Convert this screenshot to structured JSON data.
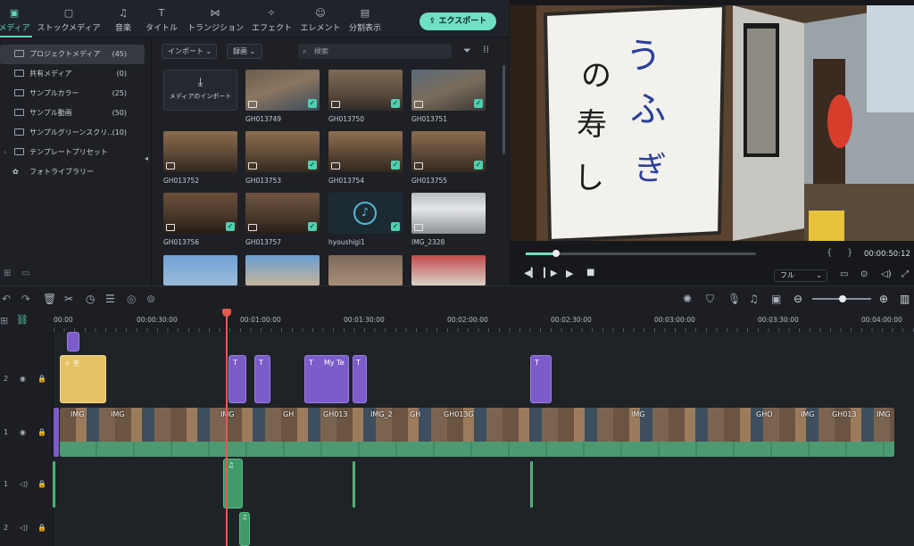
{
  "tabs": [
    {
      "label": "メディア",
      "icon": "media-icon"
    },
    {
      "label": "ストックメディア",
      "icon": "stock-media-icon"
    },
    {
      "label": "音楽",
      "icon": "music-icon"
    },
    {
      "label": "タイトル",
      "icon": "title-icon"
    },
    {
      "label": "トランジション",
      "icon": "transition-icon"
    },
    {
      "label": "エフェクト",
      "icon": "effect-icon"
    },
    {
      "label": "エレメント",
      "icon": "element-icon"
    },
    {
      "label": "分割表示",
      "icon": "split-icon"
    }
  ],
  "export_label": "エクスポート",
  "sidebar": [
    {
      "label": "プロジェクトメディア",
      "count": "(45)"
    },
    {
      "label": "共有メディア",
      "count": "(0)"
    },
    {
      "label": "サンプルカラー",
      "count": "(25)"
    },
    {
      "label": "サンプル動画",
      "count": "(50)"
    },
    {
      "label": "サンプルグリーンスクリ…",
      "count": "(10)"
    },
    {
      "label": "テンプレートプリセット",
      "count": ""
    },
    {
      "label": "フォトライブラリー",
      "count": ""
    }
  ],
  "media_toolbar": {
    "import_label": "インポート",
    "record_label": "録画",
    "search_placeholder": "検索"
  },
  "import_tile": "メディアのインポート",
  "media_items": [
    "GH013749",
    "GH013750",
    "GH013751",
    "GH013752",
    "GH013753",
    "GH013754",
    "GH013755",
    "GH013756",
    "GH013757",
    "hyoushigi1",
    "IMG_2328"
  ],
  "preview": {
    "timecode": "00:00:50:12",
    "quality": "フル",
    "progress": 0.14
  },
  "ruler_labels": [
    "00:00",
    "00:00:30:00",
    "00:01:00:00",
    "00:01:30:00",
    "00:02:00:00",
    "00:02:30:00",
    "00:03:00:00",
    "00:03:30:00",
    "00:04:00:00"
  ],
  "tracks": {
    "t2": "2",
    "v1": "1",
    "a1": "1",
    "a2": "2"
  },
  "clip_labels": {
    "title_clip": "My Te",
    "video_clips": [
      "IMG",
      "IMG",
      "IMG",
      "GH",
      "GH013",
      "IMG_2",
      "GH",
      "GH013G",
      "IMG",
      "GHO",
      "IMG",
      "GH013",
      "IMG"
    ]
  },
  "colors": {
    "accent": "#5fd6b9",
    "playhead": "#e55a4e",
    "title_clip": "#7b5cc9",
    "video_clip": "#3f9a68"
  }
}
